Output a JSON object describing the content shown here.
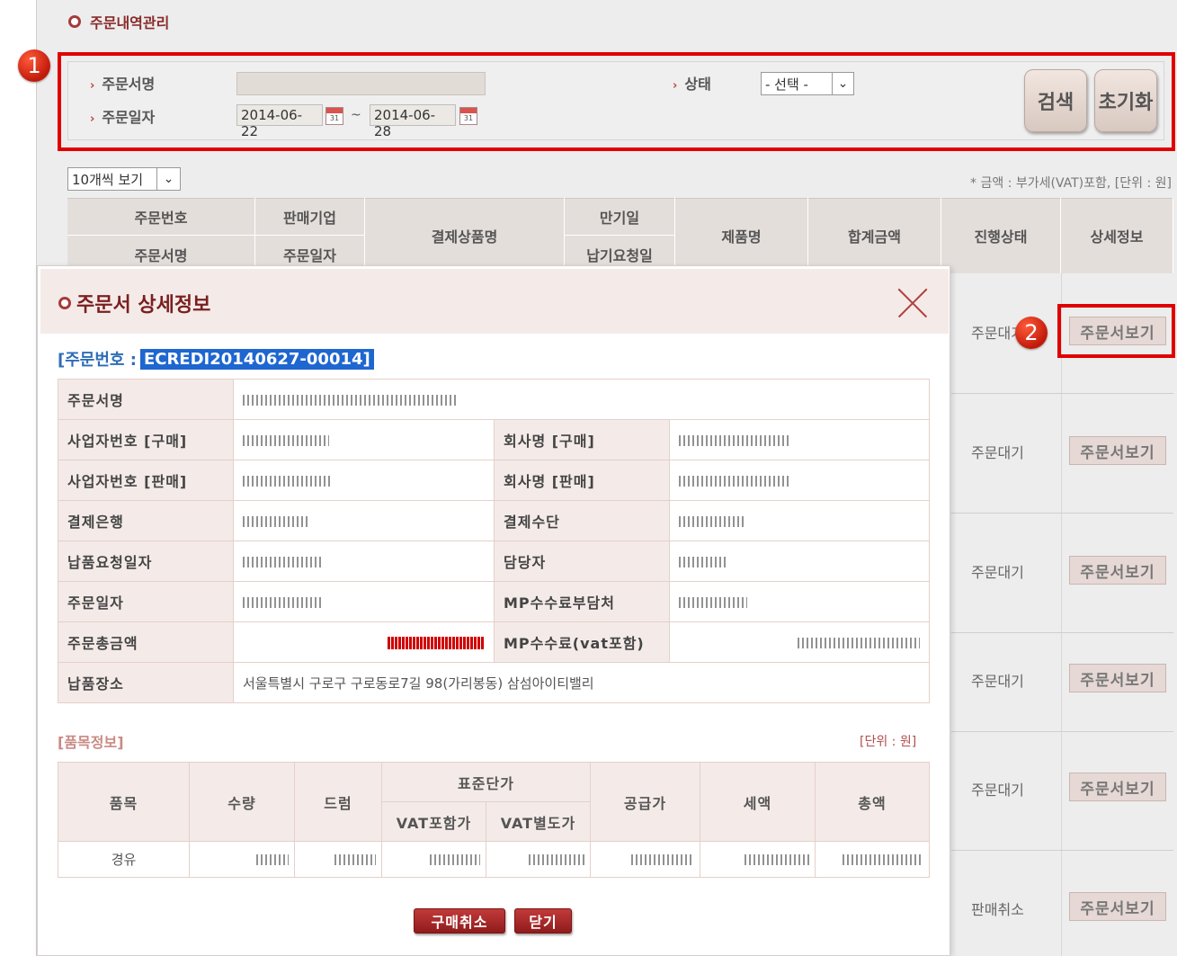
{
  "page": {
    "title": "주문내역관리"
  },
  "search": {
    "order_name_label": "주문서명",
    "order_date_label": "주문일자",
    "date_from": "2014-06-22",
    "date_to": "2014-06-28",
    "tilde": "~",
    "status_label": "상태",
    "status_value": "- 선택 -",
    "search_button": "검색",
    "reset_button": "초기화"
  },
  "list": {
    "per_page": "10개씩 보기",
    "unit_note": "* 금액 : 부가세(VAT)포함, [단위 : 원]",
    "headers": {
      "order_no": "주문번호",
      "order_name": "주문서명",
      "seller": "판매기업",
      "order_date": "주문일자",
      "product_name": "결제상품명",
      "due_date": "만기일",
      "delivery_request": "납기요청일",
      "item_name": "제품명",
      "total": "합계금액",
      "progress": "진행상태",
      "detail": "상세정보"
    },
    "rows": [
      {
        "status": "주문대기",
        "button": "주문서보기"
      },
      {
        "status": "주문대기",
        "button": "주문서보기"
      },
      {
        "status": "주문대기",
        "button": "주문서보기"
      },
      {
        "status": "주문대기",
        "button": "주문서보기"
      },
      {
        "status": "주문대기",
        "button": "주문서보기"
      },
      {
        "status": "판매취소",
        "button": "주문서보기"
      }
    ]
  },
  "annotations": {
    "badge1": "1",
    "badge2": "2"
  },
  "modal": {
    "title": "주문서 상세정보",
    "order_no_label": "[주문번호 : ",
    "order_no_value": "ECREDI20140627-00014]",
    "labels": {
      "order_name": "주문서명",
      "biz_no_buy": "사업자번호 [구매]",
      "company_buy": "회사명 [구매]",
      "biz_no_sell": "사업자번호 [판매]",
      "company_sell": "회사명 [판매]",
      "pay_bank": "결제은행",
      "pay_method": "결제수단",
      "delivery_req_date": "납품요청일자",
      "manager": "담당자",
      "order_date": "주문일자",
      "mp_fee_payer": "MP수수료부담처",
      "order_total": "주문총금액",
      "mp_fee": "MP수수료(vat포함)",
      "delivery_place": "납품장소"
    },
    "delivery_place_value": "서울특별시 구로구 구로동로7길 98(가리봉동) 삼섬아이티밸리",
    "items_title": "[품목정보]",
    "items_unit": "[단위 : 원]",
    "items_headers": {
      "item": "품목",
      "qty": "수량",
      "drum": "드럼",
      "std_price": "표준단가",
      "vat_incl": "VAT포함가",
      "vat_excl": "VAT별도가",
      "supply": "공급가",
      "tax": "세액",
      "total": "총액"
    },
    "items_row": {
      "item": "경유"
    },
    "buttons": {
      "cancel_purchase": "구매취소",
      "close": "닫기"
    }
  },
  "colors": {
    "accent": "#8a2b2b",
    "highlight": "#e00000",
    "selection": "#1e66d0"
  }
}
